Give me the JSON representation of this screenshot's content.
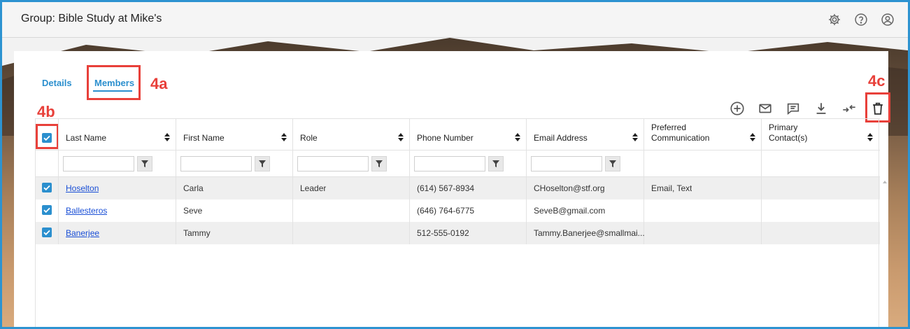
{
  "header": {
    "title": "Group: Bible Study at Mike's",
    "icons": [
      "gear-icon",
      "help-icon",
      "user-icon"
    ]
  },
  "tabs": [
    {
      "label": "Details",
      "active": false
    },
    {
      "label": "Members",
      "active": true
    }
  ],
  "callouts": {
    "a": "4a",
    "b": "4b",
    "c": "4c"
  },
  "toolbar": [
    "add-icon",
    "email-icon",
    "message-icon",
    "download-icon",
    "merge-icon",
    "delete-icon"
  ],
  "table": {
    "columns": [
      "Last Name",
      "First Name",
      "Role",
      "Phone Number",
      "Email Address",
      "Preferred Communication",
      "Primary Contact(s)"
    ],
    "rows": [
      {
        "checked": true,
        "last": "Hoselton",
        "first": "Carla",
        "role": "Leader",
        "phone": "(614) 567-8934",
        "email": "CHoselton@stf.org",
        "pref": "Email, Text",
        "primary": ""
      },
      {
        "checked": true,
        "last": "Ballesteros",
        "first": "Seve",
        "role": "",
        "phone": "(646) 764-6775",
        "email": "SeveB@gmail.com",
        "pref": "",
        "primary": ""
      },
      {
        "checked": true,
        "last": "Banerjee",
        "first": "Tammy",
        "role": "",
        "phone": "512-555-0192",
        "email": "Tammy.Banerjee@smallmai...",
        "pref": "",
        "primary": ""
      }
    ]
  },
  "colors": {
    "accent": "#2b8fce",
    "callout": "#e8403a",
    "frame": "#2d93d1",
    "link": "#1a4fd6"
  }
}
